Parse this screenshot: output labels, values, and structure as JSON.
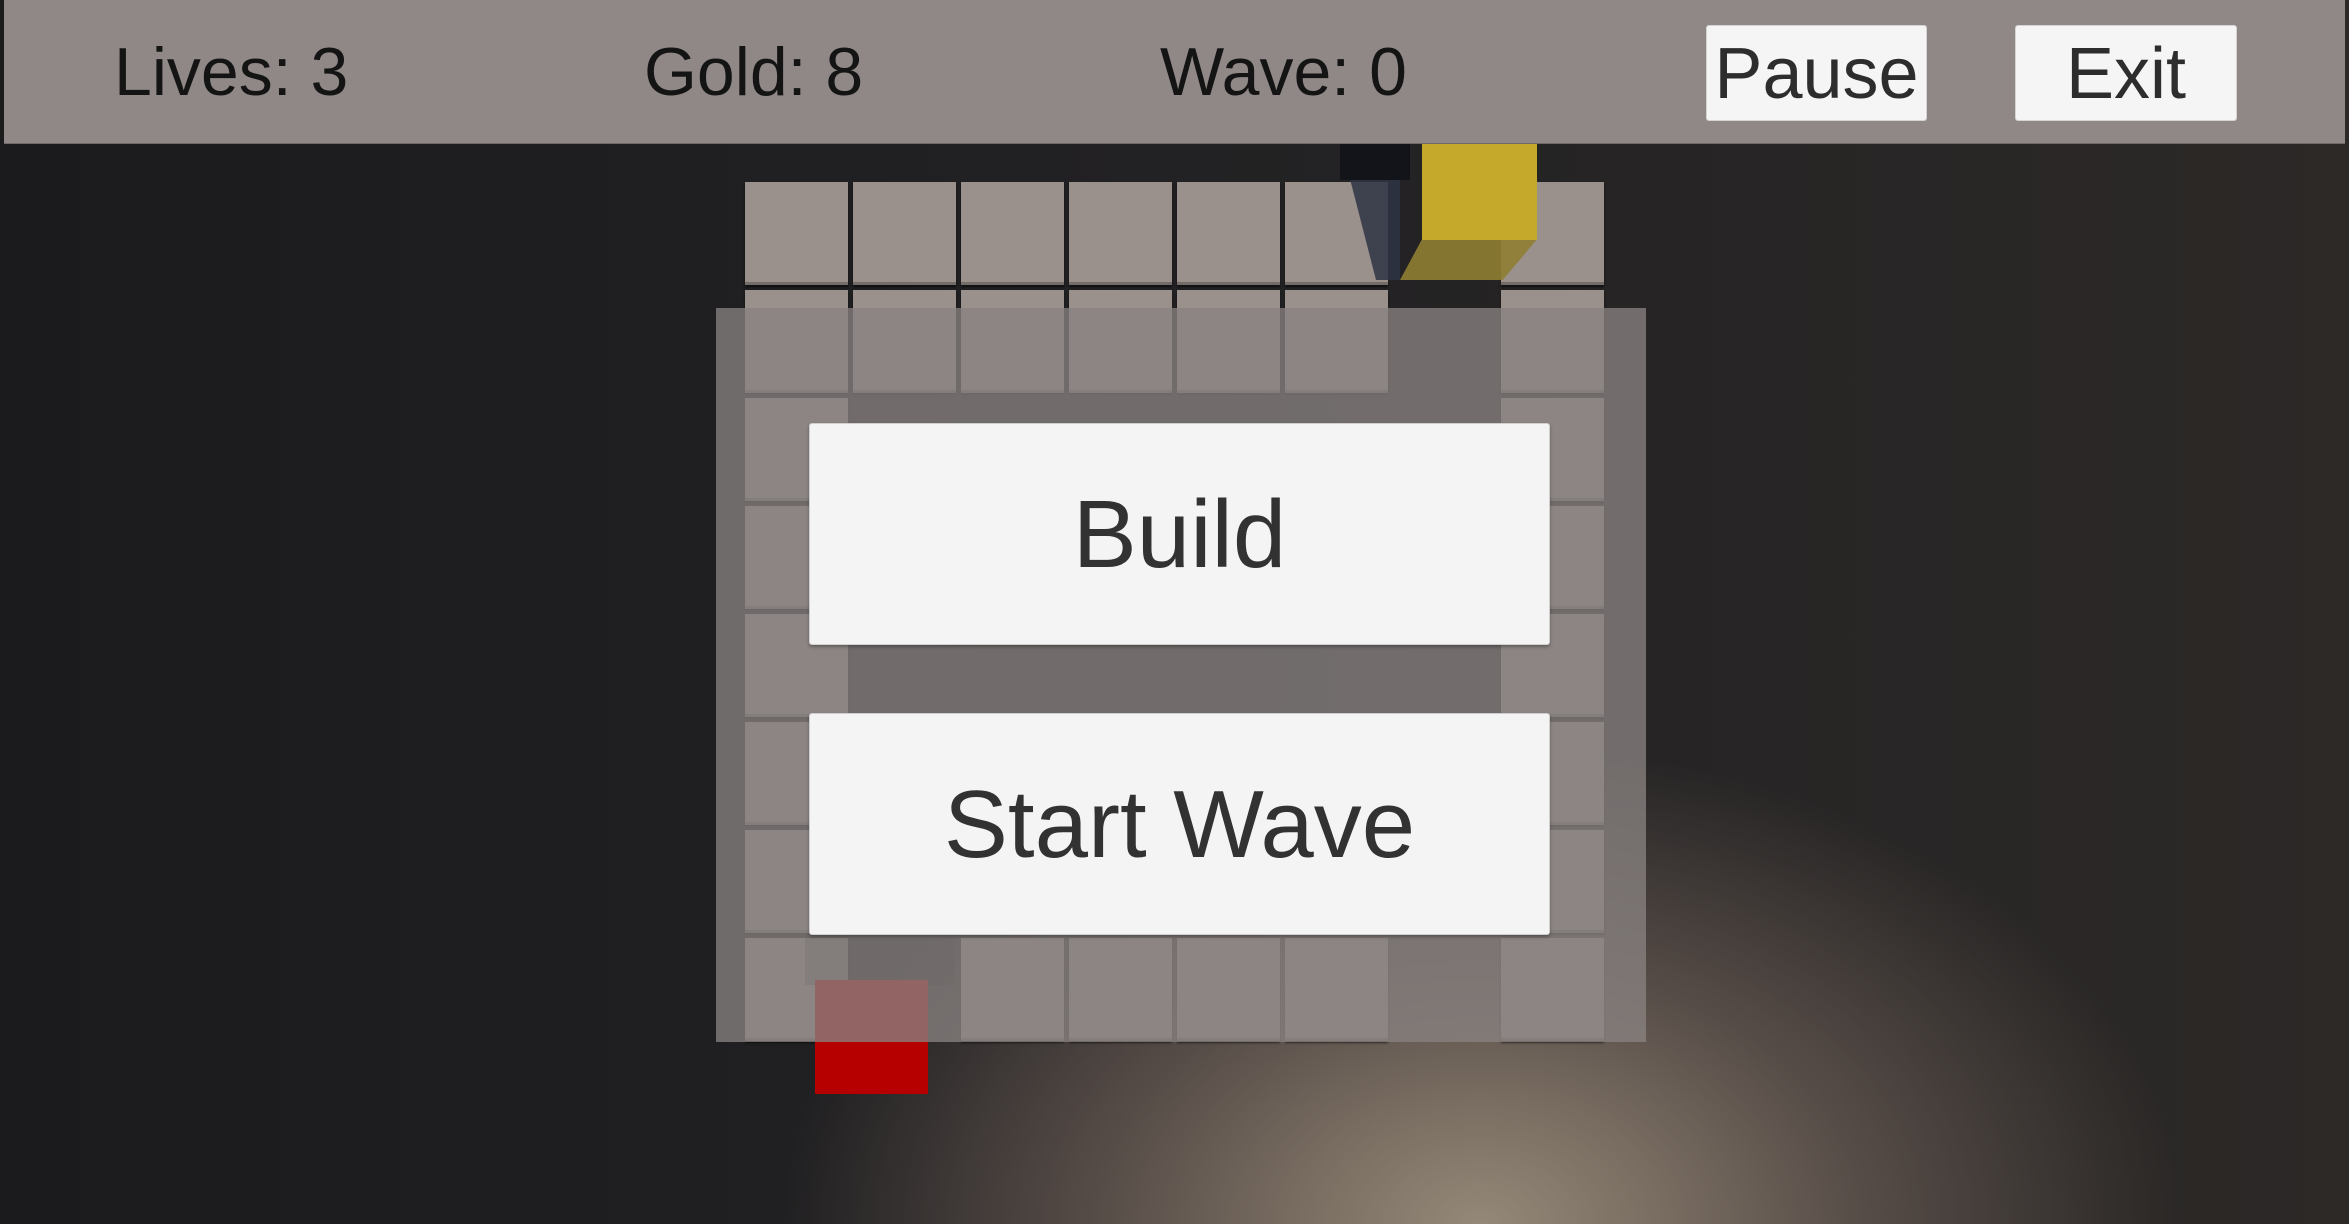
{
  "hud": {
    "lives": "Lives: 3",
    "gold": "Gold: 8",
    "wave": "Wave: 0",
    "pause_label": "Pause",
    "exit_label": "Exit"
  },
  "menu": {
    "build_label": "Build",
    "start_wave_label": "Start Wave"
  },
  "colors": {
    "tile": "#9a918d",
    "tower": "#c4a92a",
    "enemy": "#b60000",
    "hud_bar": "#8f8887"
  }
}
